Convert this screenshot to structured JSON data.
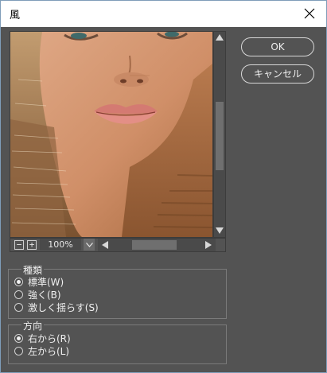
{
  "window": {
    "title": "風"
  },
  "buttons": {
    "ok": "OK",
    "cancel": "キャンセル"
  },
  "preview": {
    "zoom_out": "−",
    "zoom_in": "+",
    "zoom": "100%"
  },
  "method": {
    "label": "種類",
    "options": [
      {
        "label": "標準(W)",
        "selected": true
      },
      {
        "label": "強く(B)",
        "selected": false
      },
      {
        "label": "激しく揺らす(S)",
        "selected": false
      }
    ]
  },
  "direction": {
    "label": "方向",
    "options": [
      {
        "label": "右から(R)",
        "selected": true
      },
      {
        "label": "左から(L)",
        "selected": false
      }
    ]
  },
  "colors": {
    "panel": "#535353",
    "border": "#7a7a7a",
    "text": "#f0f0f0"
  }
}
